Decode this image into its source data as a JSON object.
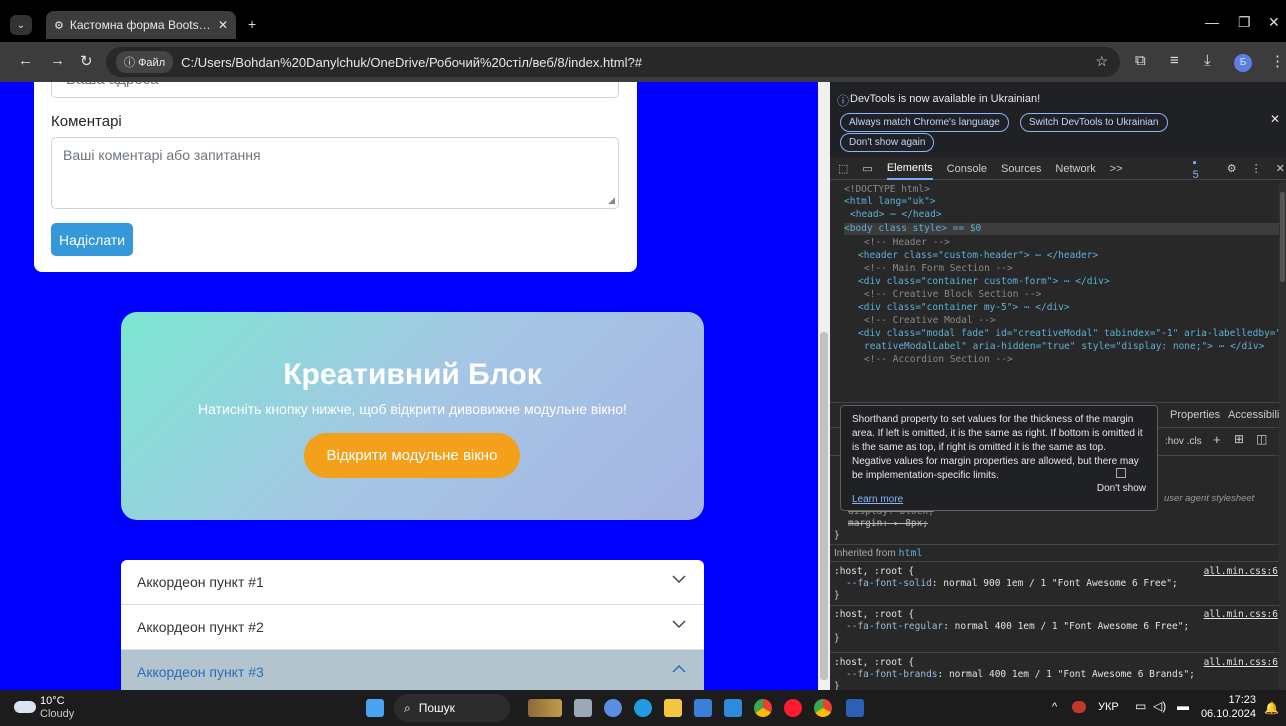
{
  "browser": {
    "tab_title": "Кастомна форма Bootstrap з п",
    "chip_label": "Файл",
    "url": "C:/Users/Bohdan%20Danylchuk/OneDrive/Робочий%20стіл/веб/8/index.html?#",
    "profile_initial": "Б"
  },
  "form": {
    "address_placeholder": "Ваша адреса",
    "comment_label": "Коментарі",
    "comment_placeholder": "Ваші коментарі або запитання",
    "submit_label": "Надіслати"
  },
  "creative": {
    "title": "Креативний Блок",
    "subtitle": "Натисніть кнопку нижче, щоб відкрити дивовижне модульне вікно!",
    "button_label": "Відкрити модульне вікно",
    "gradient": [
      "#7be7d2",
      "#a6b4e4"
    ],
    "button_color": "#f3a01b"
  },
  "accordion": {
    "items": [
      {
        "label": "Аккордеон пункт #1",
        "expanded": false
      },
      {
        "label": "Аккордеон пункт #2",
        "expanded": false
      },
      {
        "label": "Аккордеон пункт #3",
        "expanded": true
      }
    ]
  },
  "devtools": {
    "info_text": "DevTools is now available in Ukrainian!",
    "btn_match": "Always match Chrome's language",
    "btn_switch": "Switch DevTools to Ukrainian",
    "btn_dont_show": "Don't show again",
    "tabs": [
      "Elements",
      "Console",
      "Sources",
      "Network",
      ">>"
    ],
    "issues_count": "5",
    "dom_lines": [
      "<!DOCTYPE html>",
      "<html lang=\"uk\">",
      "<head> ⋯ </head>",
      "<body class style> == $0",
      "<!-- Header -->",
      "<header class=\"custom-header\"> ⋯ </header>",
      "<!-- Main Form Section -->",
      "<div class=\"container custom-form\"> ⋯ </div>",
      "<!-- Creative Block Section -->",
      "<div class=\"container my-5\"> ⋯ </div>",
      "<!-- Creative Modal -->",
      "<div class=\"modal fade\" id=\"creativeModal\" tabindex=\"-1\" aria-labelledby=\"c",
      "reativeModalLabel\" aria-hidden=\"true\" style=\"display: none;\"> ⋯ </div>",
      "<!-- Accordion Section -->"
    ],
    "tooltip": {
      "text": "Shorthand property to set values for the thickness of the margin area. If left is omitted, it is the same as right. If bottom is omitted it is the same as top, if right is omitted it is the same as top. Negative values for margin properties are allowed, but there may be implementation-specific limits.",
      "learn_more": "Learn more",
      "dont_show": "Don't show"
    },
    "styles_tabs": [
      "Properties",
      "Accessibility"
    ],
    "filter_tools": ":hov .cls",
    "ua_label": "user agent stylesheet",
    "ua_lines": [
      "display: block;",
      "margin: ▸ 8px;"
    ],
    "inherited_label": "Inherited from",
    "inherited_tag": "html",
    "rules": [
      {
        "selector": ":host, :root {",
        "prop": "--fa-font-solid",
        "value": ": normal 900 1em / 1 \"Font Awesome 6 Free\";",
        "source": "all.min.css:6"
      },
      {
        "selector": ":host, :root {",
        "prop": "--fa-font-regular",
        "value": ": normal 400 1em / 1 \"Font Awesome 6 Free\";",
        "source": "all.min.css:6"
      },
      {
        "selector": ":host, :root {",
        "prop": "--fa-font-brands",
        "value": ": normal 400 1em / 1 \"Font Awesome 6 Brands\";",
        "source": "all.min.css:6"
      }
    ]
  },
  "taskbar": {
    "temperature": "10°C",
    "weather": "Cloudy",
    "search_label": "Пошук",
    "language": "УКР",
    "time": "17:23",
    "date": "06.10.2024"
  }
}
